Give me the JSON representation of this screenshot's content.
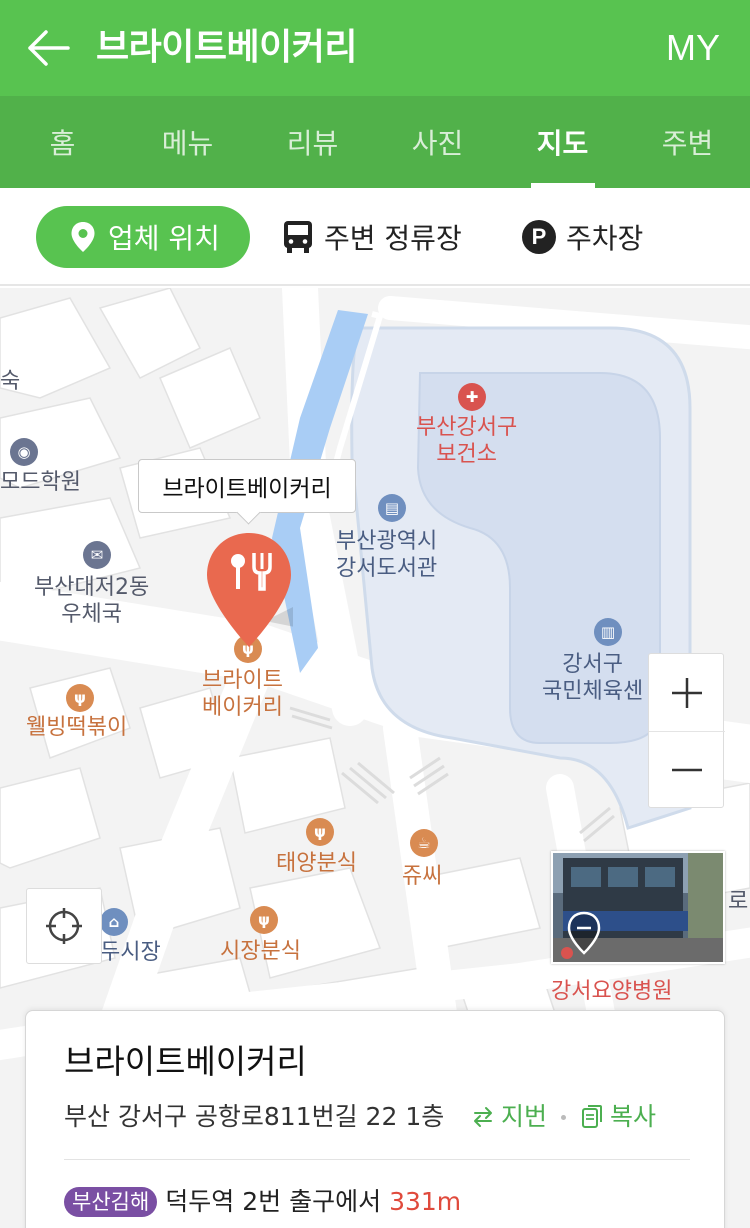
{
  "header": {
    "title": "브라이트베이커리",
    "my_label": "MY"
  },
  "tabs": [
    {
      "label": "홈",
      "active": false
    },
    {
      "label": "메뉴",
      "active": false
    },
    {
      "label": "리뷰",
      "active": false
    },
    {
      "label": "사진",
      "active": false
    },
    {
      "label": "지도",
      "active": true
    },
    {
      "label": "주변",
      "active": false
    }
  ],
  "chips": {
    "location": "업체 위치",
    "bus_stop": "주변 정류장",
    "parking": "주차장",
    "parking_icon": "P"
  },
  "map": {
    "labels": {
      "suk": "숙",
      "modo_academy": "모드학원",
      "post_office": "부산대저2동\n우체국",
      "health_center": "부산강서구\n보건소",
      "library": "부산광역시\n강서도서관",
      "gym": "강서구\n국민체육센",
      "bakery": "브라이트\n베이커리",
      "wellbing": "웰빙떡볶이",
      "taeyang": "태양분식",
      "jussi": "쥬씨",
      "market": "두시장",
      "market_snack": "시장분식",
      "hospital": "강서요양병원",
      "ro": "로"
    },
    "tooltip": "브라이트베이커리",
    "colors": {
      "water": "#a9cdf5",
      "park": "#e4eaf4",
      "park_border": "#cfdbeb",
      "road": "#ffffff",
      "block": "#f3f3f3",
      "pin": "#e9694f"
    }
  },
  "card": {
    "title": "브라이트베이커리",
    "address": "부산 강서구 공항로811번길 22 1층",
    "jibun_label": "지번",
    "copy_label": "복사",
    "line_badge": "부산김해",
    "transit_text": "덕두역 2번 출구에서",
    "distance": "331m"
  }
}
